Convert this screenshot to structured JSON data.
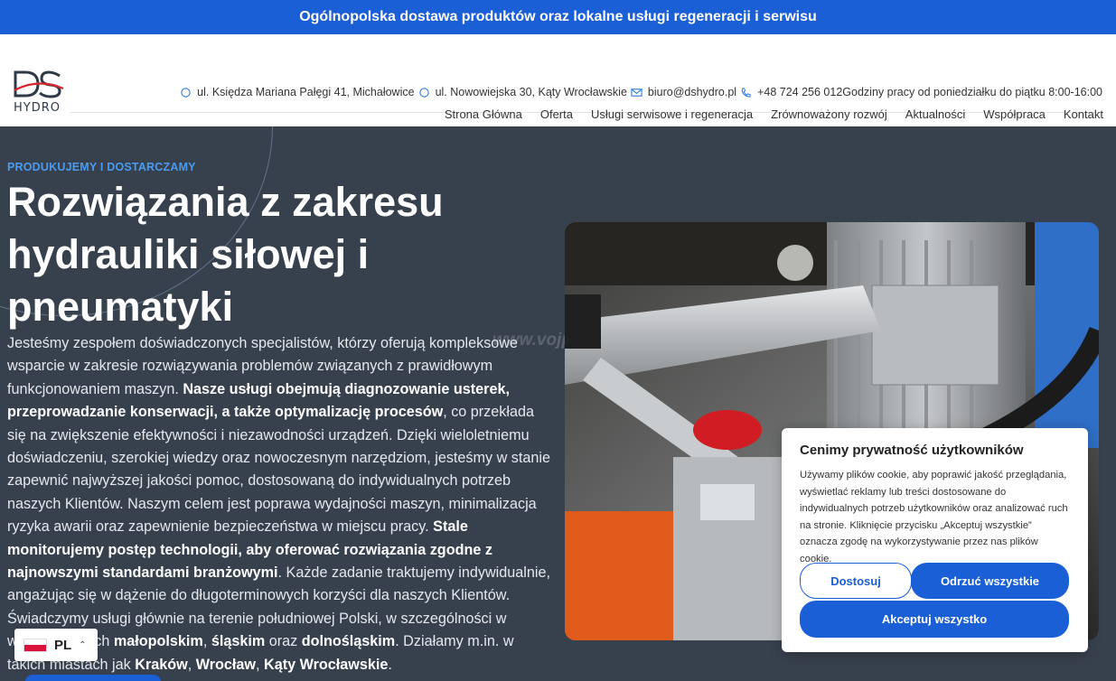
{
  "announcement": "Ogólnopolska dostawa produktów oraz lokalne usługi regeneracji i serwisu",
  "logo": {
    "text": "HYDRO",
    "mark": "DS"
  },
  "contacts": [
    {
      "icon": "location-pin-icon",
      "text": "ul. Księdza Mariana Pałęgi 41, Michałowice"
    },
    {
      "icon": "location-pin-icon",
      "text": "ul. Nowowiejska 30, Kąty Wrocławskie"
    },
    {
      "icon": "mail-icon",
      "text": "biuro@dshydro.pl"
    },
    {
      "icon": "phone-icon",
      "text": "+48 724 256 012"
    },
    {
      "icon": "none",
      "text": "Godziny pracy od poniedziałku do piątku 8:00-16:00"
    }
  ],
  "nav": [
    "Strona Główna",
    "Oferta",
    "Usługi serwisowe i regeneracja",
    "Zrównoważony rozwój",
    "Aktualności",
    "Współpraca",
    "Kontakt"
  ],
  "hero": {
    "eyebrow": "PRODUKUJEMY I DOSTARCZAMY",
    "title": "Rozwiązania z zakresu hydrauliki siłowej i pneumatyki",
    "watermark": "www.vojpoint.pl",
    "body": [
      {
        "t": "Jesteśmy zespołem doświadczonych specjalistów, którzy oferują kompleksowe wsparcie w zakresie rozwiązywania problemów związanych z prawidłowym funkcjonowaniem maszyn. ",
        "b": false
      },
      {
        "t": "Nasze usługi obejmują diagnozowanie usterek, przeprowadzanie konserwacji, a także optymalizację procesów",
        "b": true
      },
      {
        "t": ", co przekłada się na zwiększenie efektywności i niezawodności urządzeń. Dzięki wieloletniemu doświadczeniu, szerokiej wiedzy oraz nowoczesnym narzędziom, jesteśmy w stanie zapewnić najwyższej jakości pomoc, dostosowaną do indywidualnych potrzeb naszych Klientów. Naszym celem jest poprawa wydajności maszyn, minimalizacja ryzyka awarii oraz zapewnienie bezpieczeństwa w miejscu pracy. ",
        "b": false
      },
      {
        "t": "Stale monitorujemy postęp technologii, aby oferować rozwiązania zgodne z najnowszymi standardami branżowymi",
        "b": true
      },
      {
        "t": ". Każde zadanie traktujemy indywidualnie, angażując się w dążenie do długoterminowych korzyści dla naszych Klientów. Świadczymy usługi głównie na terenie południowej Polski, w szczególności w województwach ",
        "b": false
      },
      {
        "t": "małopolskim",
        "b": true
      },
      {
        "t": ", ",
        "b": false
      },
      {
        "t": "śląskim",
        "b": true
      },
      {
        "t": " oraz ",
        "b": false
      },
      {
        "t": "dolnośląskim",
        "b": true
      },
      {
        "t": ". Działamy m.in. w takich miastach jak ",
        "b": false
      },
      {
        "t": "Kraków",
        "b": true
      },
      {
        "t": ", ",
        "b": false
      },
      {
        "t": "Wrocław",
        "b": true
      },
      {
        "t": ", ",
        "b": false
      },
      {
        "t": "Kąty Wrocławskie",
        "b": true
      },
      {
        "t": ".",
        "b": false
      }
    ]
  },
  "cookie": {
    "title": "Cenimy prywatność użytkowników",
    "text": "Używamy plików cookie, aby poprawić jakość przeglądania, wyświetlać reklamy lub treści dostosowane do indywidualnych potrzeb użytkowników oraz analizować ruch na stronie. Kliknięcie przycisku „Akceptuj wszystkie” oznacza zgodę na wykorzystywanie przez nas plików cookie.",
    "customize": "Dostosuj",
    "reject": "Odrzuć wszystkie",
    "accept": "Akceptuj wszystko"
  },
  "language": {
    "code": "PL"
  },
  "colors": {
    "brand": "#1a5fd6",
    "hero_bg": "#37414d",
    "eyebrow": "#4a9bf0"
  }
}
